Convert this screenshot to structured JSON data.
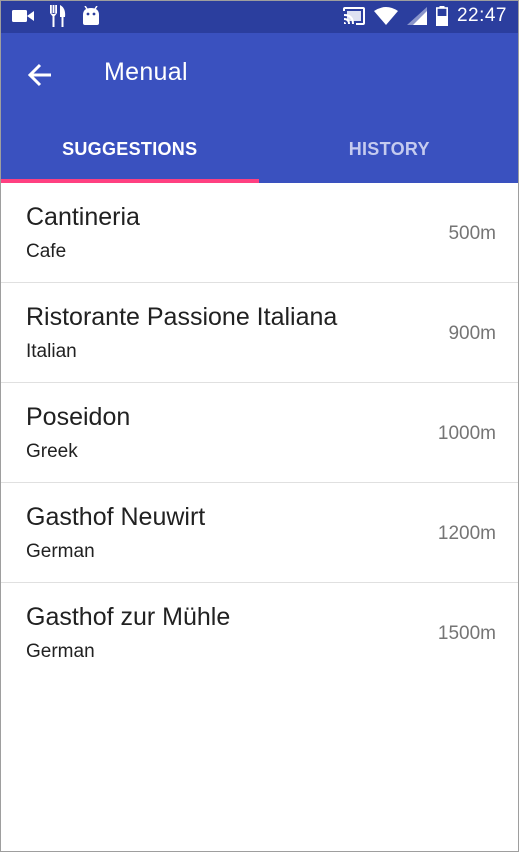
{
  "status_bar": {
    "time": "22:47",
    "left_icons": [
      "videocam-icon",
      "restaurant-icon",
      "android-icon"
    ],
    "right_icons": [
      "cast-icon",
      "wifi-icon",
      "signal-icon",
      "battery-icon"
    ]
  },
  "app_bar": {
    "title": "Menual",
    "back_icon": "arrow-back-icon"
  },
  "tabs": [
    {
      "label": "SUGGESTIONS",
      "active": true
    },
    {
      "label": "HISTORY",
      "active": false
    }
  ],
  "restaurants": [
    {
      "name": "Cantineria",
      "cuisine": "Cafe",
      "distance": "500m"
    },
    {
      "name": "Ristorante Passione Italiana",
      "cuisine": "Italian",
      "distance": "900m"
    },
    {
      "name": "Poseidon",
      "cuisine": "Greek",
      "distance": "1000m"
    },
    {
      "name": "Gasthof Neuwirt",
      "cuisine": "German",
      "distance": "1200m"
    },
    {
      "name": "Gasthof zur Mühle",
      "cuisine": "German",
      "distance": "1500m"
    }
  ],
  "colors": {
    "status_bar": "#2b3e9e",
    "primary": "#3a51bf",
    "accent": "#ff4081",
    "text_primary": "#212121",
    "text_secondary": "#757575"
  }
}
